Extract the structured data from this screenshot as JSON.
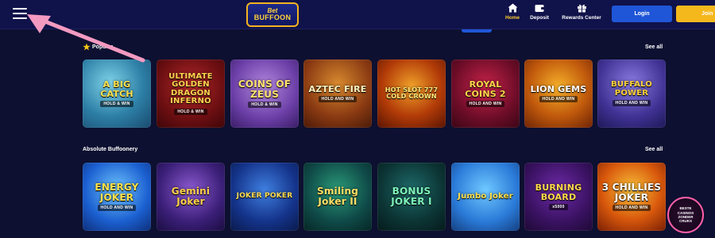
{
  "header": {
    "logo": {
      "line1": "Bet",
      "line2": "BUFFOON"
    },
    "nav": [
      {
        "label": "Home",
        "icon": "home-icon",
        "active": true
      },
      {
        "label": "Deposit",
        "icon": "wallet-icon",
        "active": false
      },
      {
        "label": "Rewards Center",
        "icon": "gift-icon",
        "active": false
      }
    ],
    "login_label": "Login",
    "join_label": "Join"
  },
  "sections": [
    {
      "title": "Popular",
      "see_all": "See all",
      "games": [
        {
          "name": "A BIG CATCH",
          "subtitle": "HOLD & WIN"
        },
        {
          "name": "ULTIMATE GOLDEN DRAGON INFERNO",
          "subtitle": "HOLD & WIN"
        },
        {
          "name": "COINS OF ZEUS",
          "subtitle": "HOLD & WIN"
        },
        {
          "name": "AZTEC FIRE",
          "subtitle": "HOLD AND WIN"
        },
        {
          "name": "HOT SLOT 777 COLD CROWN",
          "subtitle": ""
        },
        {
          "name": "ROYAL COINS 2",
          "subtitle": "HOLD AND WIN"
        },
        {
          "name": "LION GEMS",
          "subtitle": "HOLD AND WIN"
        },
        {
          "name": "BUFFALO POWER",
          "subtitle": "HOLD AND WIN"
        }
      ]
    },
    {
      "title": "Absolute Buffoonery",
      "see_all": "See all",
      "games": [
        {
          "name": "ENERGY JOKER",
          "subtitle": "HOLD AND WIN"
        },
        {
          "name": "Gemini Joker",
          "subtitle": ""
        },
        {
          "name": "JOKER POKER",
          "subtitle": ""
        },
        {
          "name": "Smiling Joker II",
          "subtitle": ""
        },
        {
          "name": "BONUS JOKER I",
          "subtitle": ""
        },
        {
          "name": "Jumbo Joker",
          "subtitle": ""
        },
        {
          "name": "BURNING BOARD",
          "subtitle": "x5000"
        },
        {
          "name": "3 CHILLIES JOKER",
          "subtitle": "HOLD AND WIN"
        }
      ]
    }
  ],
  "badge": {
    "text": "BESTE CASINOS ZONDER CRUKS"
  },
  "colors": {
    "background": "#0d1030",
    "header": "#10124a",
    "login_button": "#1f56d8",
    "join_button": "#f5b81c",
    "active_nav": "#ffcc2e",
    "annotation_arrow": "#f49ac1"
  }
}
